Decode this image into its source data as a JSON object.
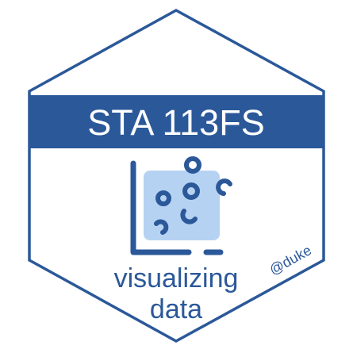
{
  "sticker": {
    "banner_title": "STA 113FS",
    "subtitle_line1": "visualizing",
    "subtitle_line2": "data",
    "handle": "@duke"
  },
  "icon": {
    "name": "scatter-plot-icon"
  },
  "colors": {
    "primary": "#2b5899",
    "icon_fill": "#b6d2f2",
    "background": "#ffffff",
    "banner_text": "#ffffff"
  }
}
